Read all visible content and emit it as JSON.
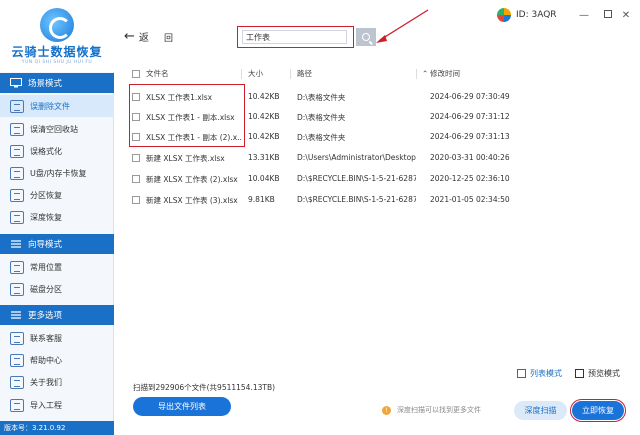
{
  "app": {
    "name": "云骑士数据恢复",
    "pinyin": "YUN QI SHI SHU JU HUI FU",
    "version_label": "版本号：3.21.0.92"
  },
  "sidebar": {
    "sections": [
      {
        "title": "场景模式",
        "items": [
          "误删除文件",
          "误清空回收站",
          "误格式化",
          "U盘/内存卡恢复",
          "分区恢复",
          "深度恢复"
        ]
      },
      {
        "title": "向导模式",
        "items": [
          "常用位置",
          "磁盘分区"
        ]
      },
      {
        "title": "更多选项",
        "items": [
          "联系客服",
          "帮助中心",
          "关于我们",
          "导入工程"
        ]
      }
    ]
  },
  "topbar": {
    "back_label": "返",
    "home_label": "回",
    "search_value": "工作表",
    "user_id": "ID: 3AQR",
    "minimize": "—",
    "close": "✕"
  },
  "table": {
    "headers": {
      "name": "文件名",
      "size": "大小",
      "path": "路径",
      "modified": "修改时间"
    },
    "rows": [
      {
        "name": "XLSX 工作表1.xlsx",
        "size": "10.42KB",
        "path": "D:\\表格文件夹",
        "modified": "2024-06-29 07:30:49"
      },
      {
        "name": "XLSX 工作表1 - 副本.xlsx",
        "size": "10.42KB",
        "path": "D:\\表格文件夹",
        "modified": "2024-06-29 07:31:12"
      },
      {
        "name": "XLSX 工作表1 - 副本 (2).x...",
        "size": "10.42KB",
        "path": "D:\\表格文件夹",
        "modified": "2024-06-29 07:31:13"
      },
      {
        "name": "新建 XLSX 工作表.xlsx",
        "size": "13.31KB",
        "path": "D:\\Users\\Administrator\\Desktop...",
        "modified": "2020-03-31 00:40:26"
      },
      {
        "name": "新建 XLSX 工作表 (2).xlsx",
        "size": "10.04KB",
        "path": "D:\\$RECYCLE.BIN\\S-1-5-21-6287...",
        "modified": "2020-12-25 02:36:10"
      },
      {
        "name": "新建 XLSX 工作表 (3).xlsx",
        "size": "9.81KB",
        "path": "D:\\$RECYCLE.BIN\\S-1-5-21-6287...",
        "modified": "2021-01-05 02:34:50"
      }
    ]
  },
  "bottom": {
    "view_list": "列表模式",
    "view_preview": "预览模式",
    "scan_info": "扫描到292906个文件(共9511154.13TB)",
    "export_label": "导出文件列表",
    "tip": "深度扫描可以找到更多文件",
    "deep_scan_label": "深度扫描",
    "recover_label": "立即恢复"
  },
  "colors": {
    "accent": "#1a73d9",
    "highlight": "#cc1f2b"
  }
}
